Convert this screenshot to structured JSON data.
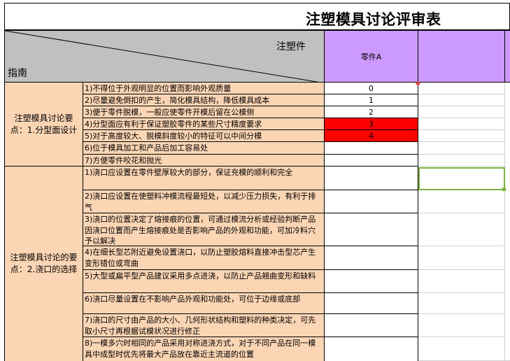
{
  "title": "注塑模具讨论评审表",
  "header": {
    "top_right_label": "注塑件",
    "bottom_left_label": "指南",
    "part_column": "零件A"
  },
  "groups": [
    {
      "label": "注塑模具讨论要点：1.分型面设计",
      "items": [
        {
          "text": "1)不得位于外观明显的位置而影响外观质量",
          "value": "0",
          "highlight": false
        },
        {
          "text": "2)尽量避免倒扣的产生，简化模具结构，降低模具成本",
          "value": "1",
          "highlight": false
        },
        {
          "text": "3)便于零件脱模，一般应使零件开模后留在公模侧",
          "value": "2",
          "highlight": false
        },
        {
          "text": "4)分型面应有利于保证塑胶零件的某些尺寸精度要求",
          "value": "3",
          "highlight": true
        },
        {
          "text": "5)对于高度较大、脱模斜度较小的特征可以中间分模",
          "value": "4",
          "highlight": true
        },
        {
          "text": "6)位于模具加工和产品后加工容易处",
          "value": "",
          "highlight": false
        },
        {
          "text": "7)方便零件咬花和抛光",
          "value": "",
          "highlight": false
        }
      ]
    },
    {
      "label": "注塑模具讨论的要点：2.浇口的选择",
      "items": [
        {
          "text": "1)浇口应设置在零件壁厚较大的部分，保证充模的顺利和完全",
          "value": ""
        },
        {
          "text": "2)浇口应设置在使塑料冲模流程最短处，以减少压力损失，有利于排气",
          "value": ""
        },
        {
          "text": "3)浇口的位置决定了熔接痕的位置，可通过模流分析或经验判断产品因浇口位置而产生熔接痕处是否影响产品的外观和功能，可加冷料穴予以解决",
          "value": ""
        },
        {
          "text": "4)在细长型芯附近避免设置浇口，以防止塑胶熔料直接冲击型芯产生变形错位或弯曲",
          "value": ""
        },
        {
          "text": "5)大型或扁平型产品建议采用多点进浇，以防止产品翘曲变形和缺料",
          "value": ""
        },
        {
          "text": "6)浇口尽量设置在不影响产品外观和功能处，可位于边缘或底部",
          "value": ""
        },
        {
          "text": "7)浇口的尺寸由产品的大小、几何形状结构和塑料的种类决定，可先取小尺寸再根据试模状况进行修正",
          "value": ""
        },
        {
          "text": "8)一模多穴时相同的产品采用对称进浇方式，对于不同产品在同一模具中成型时优先将最大产品放在靠近主流道的位置",
          "value": ""
        }
      ]
    }
  ],
  "colors": {
    "header_grey": "#c0c0c0",
    "part_purple": "#cc99ff",
    "item_peach": "#fcd5b4",
    "highlight_red": "#ff0000",
    "selection_green": "#7db43f"
  }
}
